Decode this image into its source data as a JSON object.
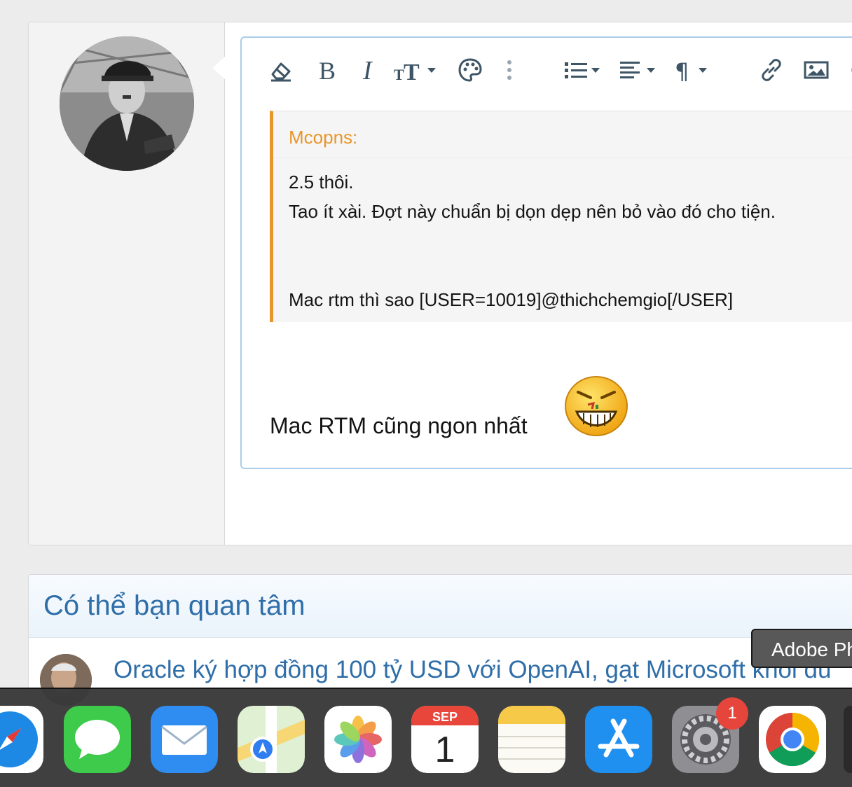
{
  "post": {
    "editor": {
      "toolbar": [
        {
          "name": "clear-formatting-button",
          "icon": "eraser-icon"
        },
        {
          "name": "bold-button",
          "icon": "bold-icon"
        },
        {
          "name": "italic-button",
          "icon": "italic-icon"
        },
        {
          "name": "font-size-button",
          "icon": "text-size-icon"
        },
        {
          "name": "text-color-button",
          "icon": "palette-icon"
        },
        {
          "name": "more-options-button",
          "icon": "vertical-ellipsis-icon"
        },
        {
          "name": "list-button",
          "icon": "list-icon"
        },
        {
          "name": "align-button",
          "icon": "align-left-icon"
        },
        {
          "name": "paragraph-button",
          "icon": "paragraph-icon"
        },
        {
          "name": "insert-link-button",
          "icon": "link-icon"
        },
        {
          "name": "insert-image-button",
          "icon": "image-icon"
        }
      ],
      "quote": {
        "author": "Mcopns:",
        "lines": [
          "2.5 thôi.",
          "Tao ít xài. Đợt này chuẩn bị dọn dẹp nên bỏ vào đó cho tiện.",
          "",
          "",
          "Mac rtm thì sao [USER=10019]@thichchemgio[/USER]"
        ]
      },
      "reply_text": "Mac RTM cũng ngon nhất"
    }
  },
  "related": {
    "title": "Có thể bạn quan tâm",
    "items": [
      {
        "title": "Oracle ký hợp đồng 100 tỷ USD với OpenAI, gạt Microsoft khỏi du"
      }
    ]
  },
  "tooltip": {
    "text": "Adobe Ph"
  },
  "dock": {
    "apps": [
      {
        "name": "Safari",
        "icon": "safari-icon"
      },
      {
        "name": "Messages",
        "icon": "messages-icon"
      },
      {
        "name": "Mail",
        "icon": "mail-icon"
      },
      {
        "name": "Maps",
        "icon": "maps-icon"
      },
      {
        "name": "Photos",
        "icon": "photos-icon"
      },
      {
        "name": "Calendar",
        "icon": "calendar-icon",
        "month": "SEP",
        "day": "1"
      },
      {
        "name": "Notes",
        "icon": "notes-icon"
      },
      {
        "name": "App Store",
        "icon": "app-store-icon"
      },
      {
        "name": "System Preferences",
        "icon": "system-preferences-icon",
        "badge": "1"
      },
      {
        "name": "Chrome",
        "icon": "chrome-icon"
      }
    ]
  },
  "colors": {
    "accent": "#2f6ea8",
    "quote_accent": "#e8962b",
    "editor_border": "#a9cdea",
    "badge": "#e5453a"
  }
}
